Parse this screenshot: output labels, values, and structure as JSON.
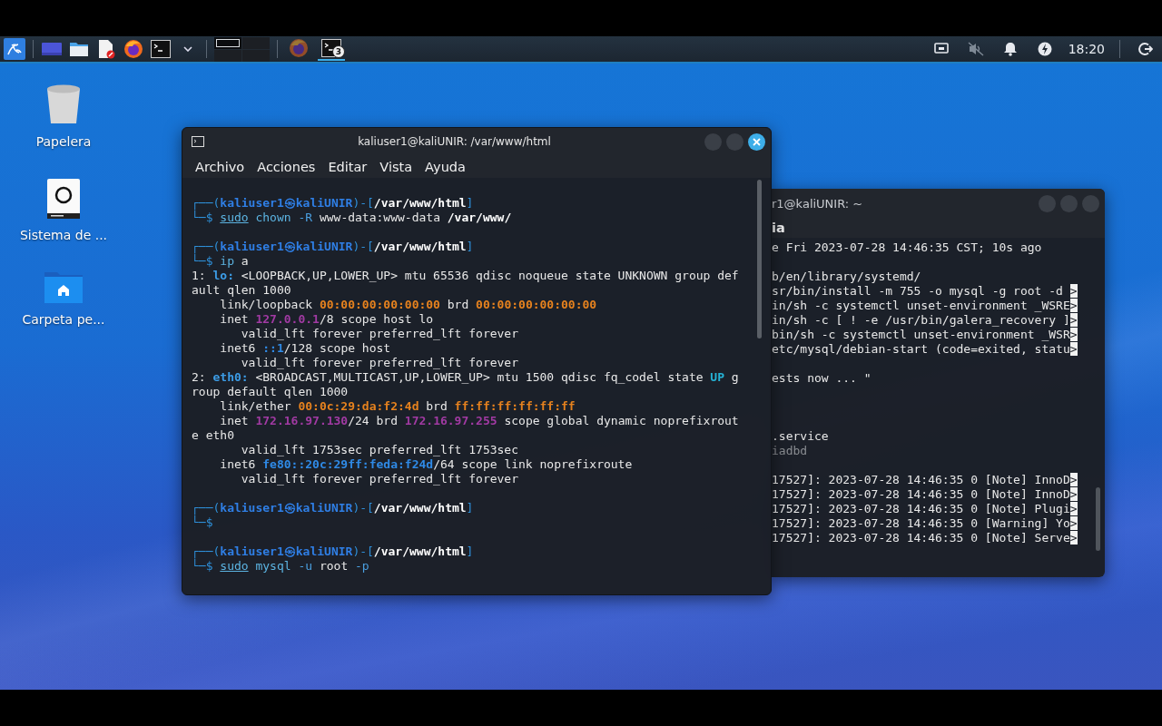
{
  "taskbar": {
    "launchers": [
      {
        "kind": "kali"
      },
      {
        "kind": "desktop"
      },
      {
        "kind": "files"
      },
      {
        "kind": "editor"
      },
      {
        "kind": "browser"
      },
      {
        "kind": "terminal"
      },
      {
        "kind": "caret"
      }
    ],
    "pager": [
      {
        "selected": true
      },
      {
        "selected": false
      },
      {
        "selected": false
      },
      {
        "selected": false
      }
    ],
    "tasks": [
      {
        "kind": "browser",
        "selected": false
      },
      {
        "kind": "terminal",
        "selected": true,
        "badge": "3"
      }
    ],
    "tray": [
      {
        "kind": "network"
      },
      {
        "kind": "muted"
      },
      {
        "kind": "bell"
      },
      {
        "kind": "power"
      }
    ],
    "clock": "18:20"
  },
  "desktop_icons": [
    {
      "kind": "trash",
      "label": "Papelera"
    },
    {
      "kind": "drive",
      "label": "Sistema de ..."
    },
    {
      "kind": "home",
      "label": "Carpeta pe..."
    }
  ],
  "terminal_back": {
    "title": "r1@kaliUNIR: ~",
    "menu": [
      "ia"
    ],
    "lines": [
      {
        "kind": "text",
        "segments": [
          {
            "kind": "plain",
            "text": "e Fri 2023-07-28 14:46:35 CST; 10s ago"
          }
        ]
      },
      {
        "kind": "blank"
      },
      {
        "kind": "text",
        "segments": [
          {
            "kind": "plain",
            "text": "b/en/library/systemd/"
          }
        ]
      },
      {
        "kind": "text",
        "segments": [
          {
            "kind": "plain",
            "text": "sr/bin/install -m 755 -o mysql -g root -d "
          },
          {
            "kind": "overflow",
            "text": ">"
          }
        ]
      },
      {
        "kind": "text",
        "segments": [
          {
            "kind": "plain",
            "text": "in/sh -c systemctl unset-environment _WSRE"
          },
          {
            "kind": "overflow",
            "text": ">"
          }
        ]
      },
      {
        "kind": "text",
        "segments": [
          {
            "kind": "plain",
            "text": "in/sh -c [ ! -e /usr/bin/galera_recovery ]"
          },
          {
            "kind": "overflow",
            "text": ">"
          }
        ]
      },
      {
        "kind": "text",
        "segments": [
          {
            "kind": "plain",
            "text": "bin/sh -c systemctl unset-environment _WSR"
          },
          {
            "kind": "overflow",
            "text": ">"
          }
        ]
      },
      {
        "kind": "text",
        "segments": [
          {
            "kind": "plain",
            "text": "etc/mysql/debian-start (code=exited, statu"
          },
          {
            "kind": "overflow",
            "text": ">"
          }
        ]
      },
      {
        "kind": "blank"
      },
      {
        "kind": "text",
        "segments": [
          {
            "kind": "plain",
            "text": "ests now ... \""
          }
        ]
      },
      {
        "kind": "blank"
      },
      {
        "kind": "blank"
      },
      {
        "kind": "blank"
      },
      {
        "kind": "text",
        "segments": [
          {
            "kind": "plain",
            "text": ".service"
          }
        ]
      },
      {
        "kind": "text",
        "segments": [
          {
            "kind": "dim",
            "text": "iadbd"
          }
        ]
      },
      {
        "kind": "blank"
      },
      {
        "kind": "text",
        "segments": [
          {
            "kind": "plain",
            "text": "17527]: 2023-07-28 14:46:35 0 [Note] InnoD"
          },
          {
            "kind": "overflow",
            "text": ">"
          }
        ]
      },
      {
        "kind": "text",
        "segments": [
          {
            "kind": "plain",
            "text": "17527]: 2023-07-28 14:46:35 0 [Note] InnoD"
          },
          {
            "kind": "overflow",
            "text": ">"
          }
        ]
      },
      {
        "kind": "text",
        "segments": [
          {
            "kind": "plain",
            "text": "17527]: 2023-07-28 14:46:35 0 [Note] Plugi"
          },
          {
            "kind": "overflow",
            "text": ">"
          }
        ]
      },
      {
        "kind": "text",
        "segments": [
          {
            "kind": "plain",
            "text": "17527]: 2023-07-28 14:46:35 0 [Warning] Yo"
          },
          {
            "kind": "overflow",
            "text": ">"
          }
        ]
      },
      {
        "kind": "text",
        "segments": [
          {
            "kind": "plain",
            "text": "17527]: 2023-07-28 14:46:35 0 [Note] Serve"
          },
          {
            "kind": "overflow",
            "text": ">"
          }
        ]
      }
    ]
  },
  "terminal_front": {
    "title": "kaliuser1@kaliUNIR: /var/www/html",
    "menu": [
      "Archivo",
      "Acciones",
      "Editar",
      "Vista",
      "Ayuda"
    ],
    "lines": [
      {
        "kind": "text",
        "segments": [
          {
            "kind": "frame",
            "text": "┌──("
          },
          {
            "kind": "userhost",
            "text": "kaliuser1㉿kaliUNIR"
          },
          {
            "kind": "frame",
            "text": ")-["
          },
          {
            "kind": "cwd",
            "text": "/var/www/html"
          },
          {
            "kind": "frame",
            "text": "]"
          }
        ]
      },
      {
        "kind": "text",
        "segments": [
          {
            "kind": "frame",
            "text": "└─$ "
          },
          {
            "kind": "sudo",
            "text": "sudo"
          },
          {
            "kind": "cmd",
            "text": " chown"
          },
          {
            "kind": "opt",
            "text": " -R"
          },
          {
            "kind": "plain",
            "text": " www-data:www-data "
          },
          {
            "kind": "argbold",
            "text": "/var/www/"
          }
        ]
      },
      {
        "kind": "blank"
      },
      {
        "kind": "text",
        "segments": [
          {
            "kind": "frame",
            "text": "┌──("
          },
          {
            "kind": "userhost",
            "text": "kaliuser1㉿kaliUNIR"
          },
          {
            "kind": "frame",
            "text": ")-["
          },
          {
            "kind": "cwd",
            "text": "/var/www/html"
          },
          {
            "kind": "frame",
            "text": "]"
          }
        ]
      },
      {
        "kind": "text",
        "segments": [
          {
            "kind": "frame",
            "text": "└─$ "
          },
          {
            "kind": "cmd",
            "text": "ip"
          },
          {
            "kind": "plain",
            "text": " a"
          }
        ]
      },
      {
        "kind": "text",
        "segments": [
          {
            "kind": "plain",
            "text": "1: "
          },
          {
            "kind": "iface",
            "text": "lo:"
          },
          {
            "kind": "plain",
            "text": " <LOOPBACK,UP,LOWER_UP> mtu 65536 qdisc noqueue state UNKNOWN group def"
          }
        ]
      },
      {
        "kind": "text",
        "segments": [
          {
            "kind": "plain",
            "text": "ault qlen 1000"
          }
        ]
      },
      {
        "kind": "text",
        "segments": [
          {
            "kind": "plain",
            "text": "    link/loopback "
          },
          {
            "kind": "mac",
            "text": "00:00:00:00:00:00"
          },
          {
            "kind": "plain",
            "text": " brd "
          },
          {
            "kind": "mac",
            "text": "00:00:00:00:00:00"
          }
        ]
      },
      {
        "kind": "text",
        "segments": [
          {
            "kind": "plain",
            "text": "    inet "
          },
          {
            "kind": "ip",
            "text": "127.0.0.1"
          },
          {
            "kind": "plain",
            "text": "/8 scope host lo"
          }
        ]
      },
      {
        "kind": "text",
        "segments": [
          {
            "kind": "plain",
            "text": "       valid_lft forever preferred_lft forever"
          }
        ]
      },
      {
        "kind": "text",
        "segments": [
          {
            "kind": "plain",
            "text": "    inet6 "
          },
          {
            "kind": "ip6",
            "text": "::1"
          },
          {
            "kind": "plain",
            "text": "/128 scope host"
          }
        ]
      },
      {
        "kind": "text",
        "segments": [
          {
            "kind": "plain",
            "text": "       valid_lft forever preferred_lft forever"
          }
        ]
      },
      {
        "kind": "text",
        "segments": [
          {
            "kind": "plain",
            "text": "2: "
          },
          {
            "kind": "iface",
            "text": "eth0:"
          },
          {
            "kind": "plain",
            "text": " <BROADCAST,MULTICAST,UP,LOWER_UP> mtu 1500 qdisc fq_codel state "
          },
          {
            "kind": "state",
            "text": "UP"
          },
          {
            "kind": "plain",
            "text": " g"
          }
        ]
      },
      {
        "kind": "text",
        "segments": [
          {
            "kind": "plain",
            "text": "roup default qlen 1000"
          }
        ]
      },
      {
        "kind": "text",
        "segments": [
          {
            "kind": "plain",
            "text": "    link/ether "
          },
          {
            "kind": "mac",
            "text": "00:0c:29:da:f2:4d"
          },
          {
            "kind": "plain",
            "text": " brd "
          },
          {
            "kind": "mac",
            "text": "ff:ff:ff:ff:ff:ff"
          }
        ]
      },
      {
        "kind": "text",
        "segments": [
          {
            "kind": "plain",
            "text": "    inet "
          },
          {
            "kind": "ip",
            "text": "172.16.97.130"
          },
          {
            "kind": "plain",
            "text": "/24 brd "
          },
          {
            "kind": "ip",
            "text": "172.16.97.255"
          },
          {
            "kind": "plain",
            "text": " scope global dynamic noprefixrout"
          }
        ]
      },
      {
        "kind": "text",
        "segments": [
          {
            "kind": "plain",
            "text": "e eth0"
          }
        ]
      },
      {
        "kind": "text",
        "segments": [
          {
            "kind": "plain",
            "text": "       valid_lft 1753sec preferred_lft 1753sec"
          }
        ]
      },
      {
        "kind": "text",
        "segments": [
          {
            "kind": "plain",
            "text": "    inet6 "
          },
          {
            "kind": "ip6",
            "text": "fe80::20c:29ff:feda:f24d"
          },
          {
            "kind": "plain",
            "text": "/64 scope link noprefixroute"
          }
        ]
      },
      {
        "kind": "text",
        "segments": [
          {
            "kind": "plain",
            "text": "       valid_lft forever preferred_lft forever"
          }
        ]
      },
      {
        "kind": "blank"
      },
      {
        "kind": "text",
        "segments": [
          {
            "kind": "frame",
            "text": "┌──("
          },
          {
            "kind": "userhost",
            "text": "kaliuser1㉿kaliUNIR"
          },
          {
            "kind": "frame",
            "text": ")-["
          },
          {
            "kind": "cwd",
            "text": "/var/www/html"
          },
          {
            "kind": "frame",
            "text": "]"
          }
        ]
      },
      {
        "kind": "text",
        "segments": [
          {
            "kind": "frame",
            "text": "└─$"
          }
        ]
      },
      {
        "kind": "blank"
      },
      {
        "kind": "text",
        "segments": [
          {
            "kind": "frame",
            "text": "┌──("
          },
          {
            "kind": "userhost",
            "text": "kaliuser1㉿kaliUNIR"
          },
          {
            "kind": "frame",
            "text": ")-["
          },
          {
            "kind": "cwd",
            "text": "/var/www/html"
          },
          {
            "kind": "frame",
            "text": "]"
          }
        ]
      },
      {
        "kind": "text",
        "segments": [
          {
            "kind": "frame",
            "text": "└─$ "
          },
          {
            "kind": "sudo",
            "text": "sudo"
          },
          {
            "kind": "cmd",
            "text": " mysql"
          },
          {
            "kind": "opt",
            "text": " -u"
          },
          {
            "kind": "plain",
            "text": " root "
          },
          {
            "kind": "opt",
            "text": "-p"
          }
        ]
      }
    ]
  }
}
